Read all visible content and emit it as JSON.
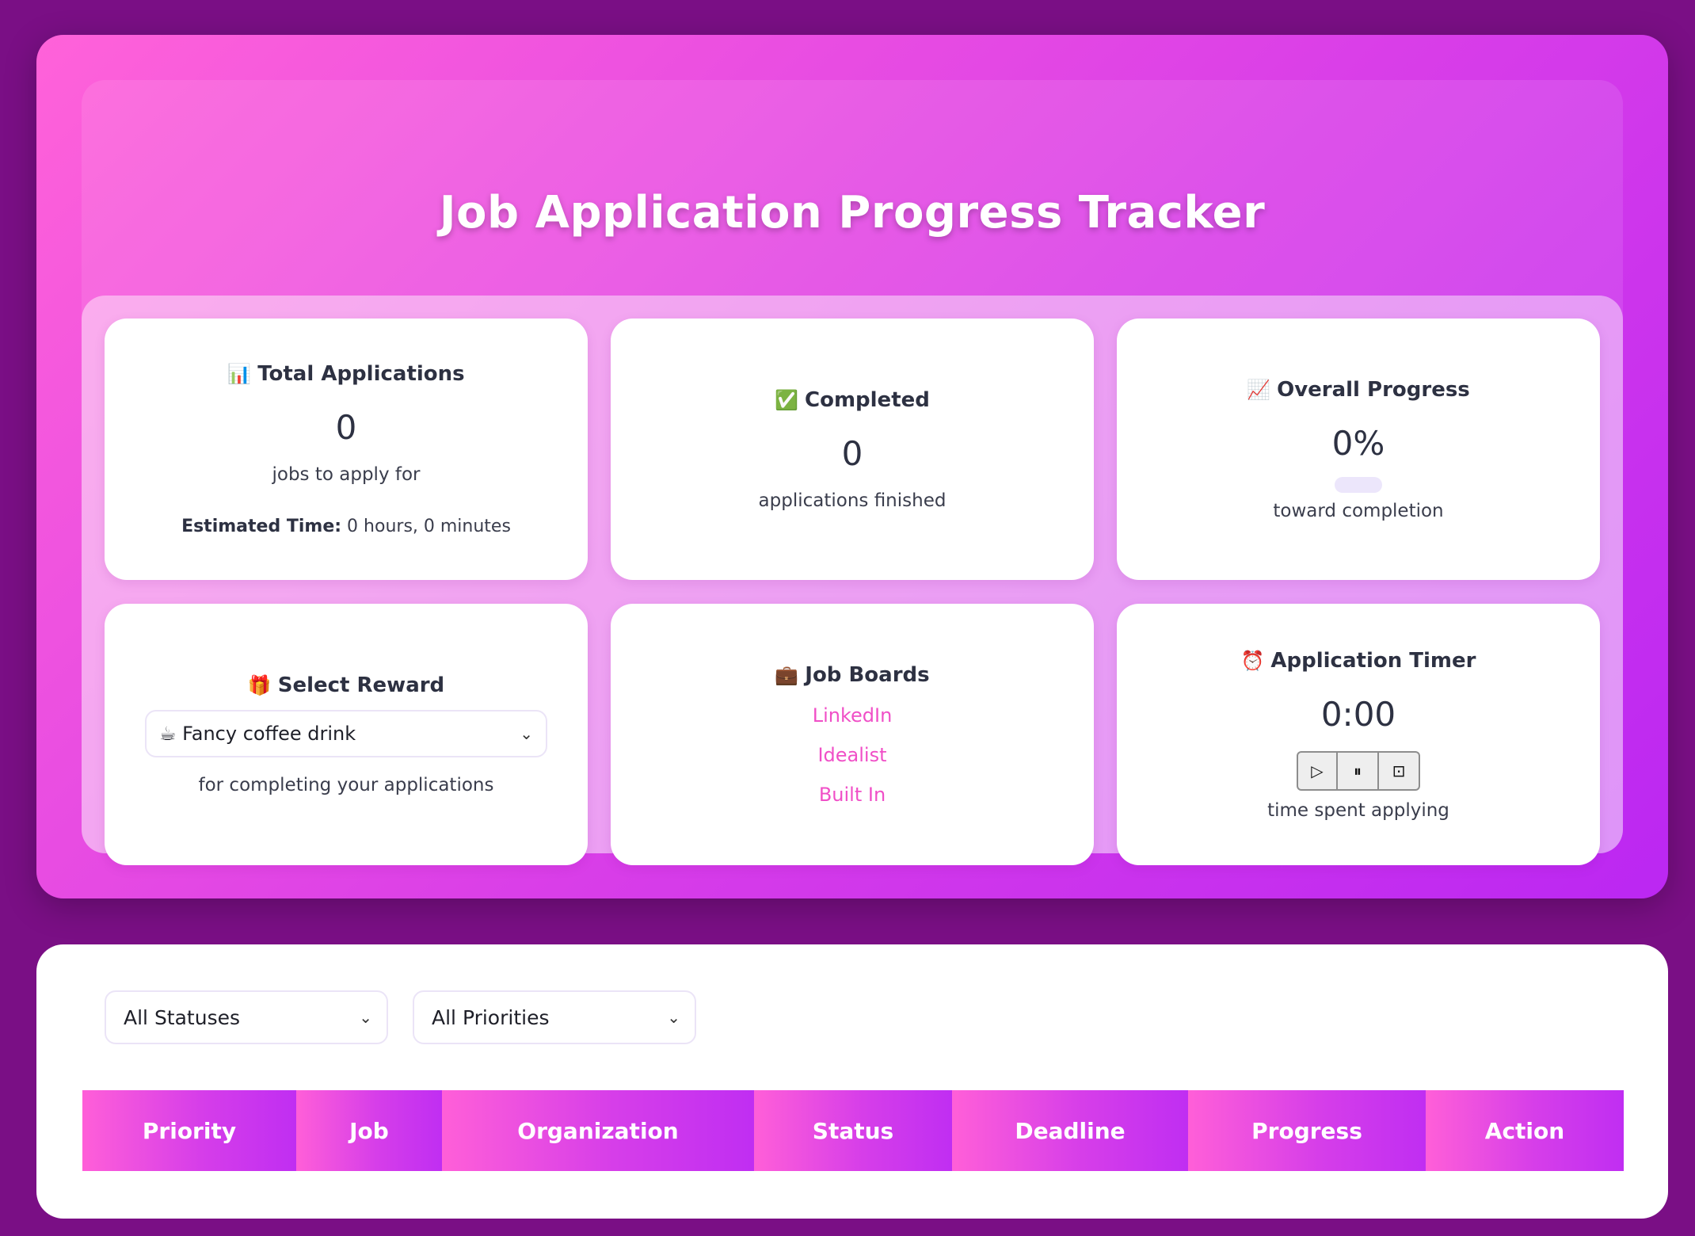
{
  "header": {
    "title": "Job Application Progress Tracker"
  },
  "cards": {
    "total": {
      "icon": "📊",
      "title": "Total Applications",
      "value": "0",
      "subtitle": "jobs to apply for",
      "estimate_label": "Estimated Time:",
      "estimate_value": " 0 hours, 0 minutes"
    },
    "completed": {
      "icon": "✅",
      "title": "Completed",
      "value": "0",
      "subtitle": "applications finished"
    },
    "progress": {
      "icon": "📈",
      "title": "Overall Progress",
      "value": "0%",
      "percent": 0,
      "subtitle": "toward completion"
    },
    "reward": {
      "icon": "🎁",
      "title": "Select Reward",
      "selected": "☕ Fancy coffee drink",
      "subtitle": "for completing your applications"
    },
    "boards": {
      "icon": "💼",
      "title": "Job Boards",
      "links": [
        "LinkedIn",
        "Idealist",
        "Built In"
      ]
    },
    "timer": {
      "icon": "⏰",
      "title": "Application Timer",
      "value": "0:00",
      "subtitle": "time spent applying",
      "buttons": {
        "play": "▷",
        "pause": "⏸",
        "stop": "⊡"
      }
    }
  },
  "filters": {
    "status": "All Statuses",
    "priority": "All Priorities"
  },
  "table": {
    "headers": [
      "Priority",
      "Job",
      "Organization",
      "Status",
      "Deadline",
      "Progress",
      "Action"
    ]
  },
  "colors": {
    "accent": "#f04fc7",
    "background": "#7a0f85"
  }
}
